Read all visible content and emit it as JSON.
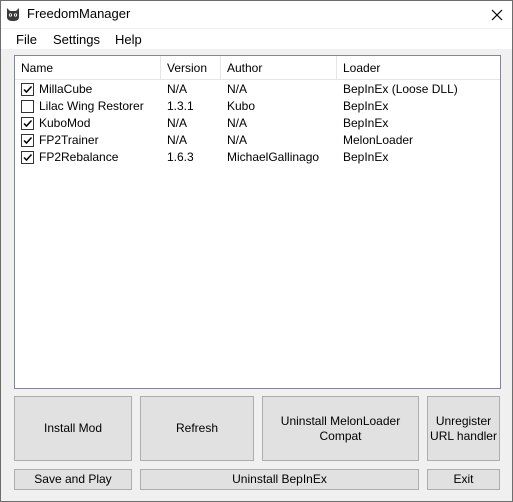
{
  "window": {
    "title": "FreedomManager"
  },
  "menu": {
    "items": [
      "File",
      "Settings",
      "Help"
    ]
  },
  "mod_list": {
    "columns": [
      "Name",
      "Version",
      "Author",
      "Loader"
    ],
    "rows": [
      {
        "checked": true,
        "name": "MillaCube",
        "version": "N/A",
        "author": "N/A",
        "loader": "BepInEx (Loose DLL)"
      },
      {
        "checked": false,
        "name": "Lilac Wing Restorer",
        "version": "1.3.1",
        "author": "Kubo",
        "loader": "BepInEx"
      },
      {
        "checked": true,
        "name": "KuboMod",
        "version": "N/A",
        "author": "N/A",
        "loader": "BepInEx"
      },
      {
        "checked": true,
        "name": "FP2Trainer",
        "version": "N/A",
        "author": "N/A",
        "loader": "MelonLoader"
      },
      {
        "checked": true,
        "name": "FP2Rebalance",
        "version": "1.6.3",
        "author": "MichaelGallinago",
        "loader": "BepInEx"
      }
    ]
  },
  "buttons": {
    "install_mod": "Install Mod",
    "refresh": "Refresh",
    "uninstall_melonloader_compat": "Uninstall MelonLoader Compat",
    "unregister_url_line1": "Unregister",
    "unregister_url_line2": "URL handler",
    "save_and_play": "Save and Play",
    "uninstall_bepinex": "Uninstall BepInEx",
    "exit": "Exit"
  },
  "icons": {
    "app": "cat-face-icon",
    "close": "close-icon",
    "check": "checkmark-icon"
  }
}
